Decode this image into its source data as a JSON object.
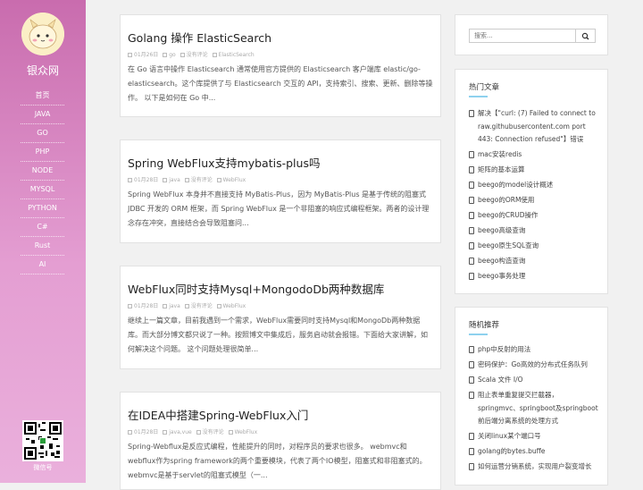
{
  "site": {
    "name": "银众网",
    "qr_label": "微信号"
  },
  "nav": [
    "首页",
    "JAVA",
    "GO",
    "PHP",
    "NODE",
    "MYSQL",
    "PYTHON",
    "C#",
    "Rust",
    "AI"
  ],
  "posts": [
    {
      "title": "Golang 操作 ElasticSearch",
      "date": "01月26日",
      "category": "go",
      "comments": "没有评论",
      "tag": "ElasticSearch",
      "excerpt": "在 Go 语言中操作 Elasticsearch 通常使用官方提供的 Elasticsearch 客户端库 elastic/go-elasticsearch。这个库提供了与 Elasticsearch 交互的 API，支持索引、搜索、更新、删除等操作。 以下是如何在 Go 中..."
    },
    {
      "title": "Spring WebFlux支持mybatis-plus吗",
      "date": "01月28日",
      "category": "java",
      "comments": "没有评论",
      "tag": "WebFlux",
      "excerpt": "Spring WebFlux 本身并不直接支持 MyBatis-Plus，因为 MyBatis-Plus 是基于传统的阻塞式 JDBC 开发的 ORM 框架，而 Spring WebFlux 是一个非阻塞的响应式编程框架。两者的设计理念存在冲突，直接结合会导致阻塞问..."
    },
    {
      "title": "WebFlux同时支持Mysql+MongodoDb两种数据库",
      "date": "01月28日",
      "category": "java",
      "comments": "没有评论",
      "tag": "WebFlux",
      "excerpt": "继续上一篇文章，目前我遇到一个需求，WebFlux需要同时支持Mysql和MongoDb两种数据库。而大部分博文都只说了一种。按照博文中集成后，服务启动就会报错。下面给大家讲解，如何解决这个问题。 这个问题处理很简单..."
    },
    {
      "title": "在IDEA中搭建Spring-WebFlux入门",
      "date": "01月28日",
      "category": "java,vue",
      "comments": "没有评论",
      "tag": "WebFlux",
      "excerpt": "Spring-Webflux是反应式编程，性能提升的同时，对程序员的要求也很多。 webmvc和webflux作为spring framework的两个重要模块，代表了两个IO模型，阻塞式和非阻塞式的。 webmvc是基于servlet的阻塞式模型（一..."
    }
  ],
  "search": {
    "placeholder": "搜索..."
  },
  "hot": {
    "title": "热门文章",
    "items": [
      "解决【\"curl: (7) Failed to connect to raw.githubusercontent.com port 443: Connection refused\"】错误",
      "mac安装redis",
      "矩阵的基本运算",
      "beego的model设计概述",
      "beego的ORM使用",
      "beego的CRUD操作",
      "beego高级查询",
      "beego原生SQL查询",
      "beego构造查询",
      "beego事务处理"
    ]
  },
  "random": {
    "title": "随机推荐",
    "items": [
      "php中反射的用法",
      "密码保护：Go高效的分布式任务队列",
      "Scala 文件 I/O",
      "阻止表单重复提交拦截器，springmvc、springboot及springboot前后端分离系统的处理方式",
      "关闭linux某个端口号",
      "golang的bytes.buffe",
      "如何运营分销系统，实现用户裂变增长"
    ]
  },
  "colors": {
    "accent": "#8ed1ee",
    "sidebar_top": "#c96cae",
    "sidebar_bottom": "#eab0dc"
  }
}
